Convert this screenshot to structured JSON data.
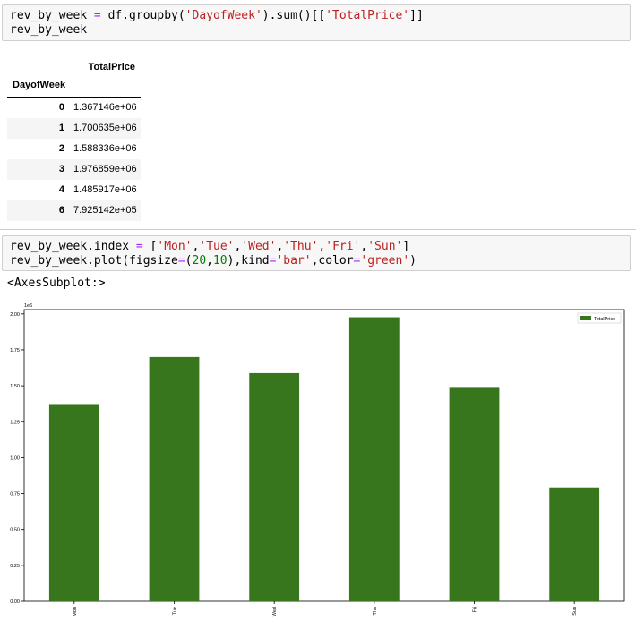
{
  "cell1": {
    "code_line1_parts": [
      "rev_by_week ",
      "=",
      " df.groupby(",
      "'DayofWeek'",
      ").sum()[[",
      "'TotalPrice'",
      "]]"
    ],
    "code_line2": "rev_by_week"
  },
  "dataframe": {
    "column_header": "TotalPrice",
    "index_name": "DayofWeek",
    "rows": [
      {
        "index": "0",
        "value": "1.367146e+06"
      },
      {
        "index": "1",
        "value": "1.700635e+06"
      },
      {
        "index": "2",
        "value": "1.588336e+06"
      },
      {
        "index": "3",
        "value": "1.976859e+06"
      },
      {
        "index": "4",
        "value": "1.485917e+06"
      },
      {
        "index": "6",
        "value": "7.925142e+05"
      }
    ]
  },
  "cell2": {
    "line1_parts": [
      "rev_by_week.index ",
      "=",
      " [",
      "'Mon'",
      ",",
      "'Tue'",
      ",",
      "'Wed'",
      ",",
      "'Thu'",
      ",",
      "'Fri'",
      ",",
      "'Sun'",
      "]"
    ],
    "line2_parts": [
      "rev_by_week.plot(figsize",
      "=",
      "(",
      "20",
      ",",
      "10",
      "),kind",
      "=",
      "'bar'",
      ",color",
      "=",
      "'green'",
      ")"
    ]
  },
  "output_label": "<AxesSubplot:>",
  "colors": {
    "bar": "#38761d",
    "keyword_string": "#ba2121",
    "operator": "#aa22ff",
    "number": "#008000"
  },
  "chart_data": {
    "type": "bar",
    "categories": [
      "Mon",
      "Tue",
      "Wed",
      "Thu",
      "Fri",
      "Sun"
    ],
    "series": [
      {
        "name": "TotalPrice",
        "values": [
          1367146,
          1700635,
          1588336,
          1976859,
          1485917,
          792514.2
        ]
      }
    ],
    "ylim": [
      0,
      2030000
    ],
    "scale_label": "1e6",
    "yticks": [
      0,
      250000,
      500000,
      750000,
      1000000,
      1250000,
      1500000,
      1750000,
      2000000
    ],
    "ytick_labels": [
      "0.00",
      "0.25",
      "0.50",
      "0.75",
      "1.00",
      "1.25",
      "1.50",
      "1.75",
      "2.00"
    ],
    "legend": "top-right",
    "grid": false,
    "title": "",
    "xlabel": "",
    "ylabel": ""
  }
}
